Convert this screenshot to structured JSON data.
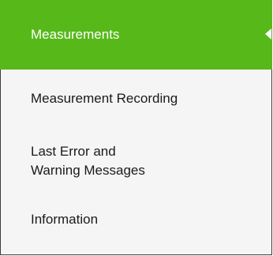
{
  "menu": {
    "items": [
      {
        "label": "Measurements",
        "active": true
      },
      {
        "label": "Measurement Recording",
        "active": false
      },
      {
        "label_line1": "Last Error and",
        "label_line2": "Warning Messages",
        "active": false
      },
      {
        "label": "Information",
        "active": false
      }
    ]
  },
  "colors": {
    "active_background": "#57b81a",
    "active_text": "#ffffff",
    "menu_background": "#f5f5f5",
    "text": "#1a1a1a",
    "border": "#3a3a3a"
  }
}
